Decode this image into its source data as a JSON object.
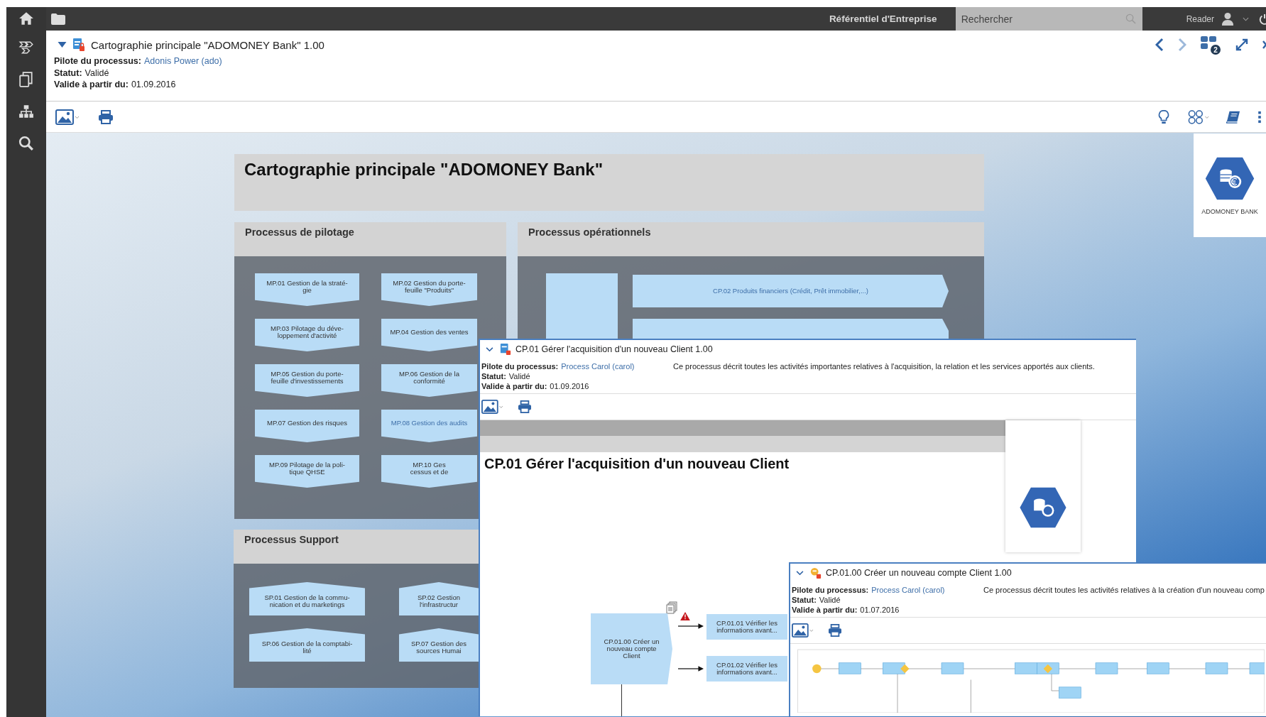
{
  "top_bar": {
    "repository": "Référentiel d'Entreprise",
    "search": {
      "placeholder": "Rechercher"
    },
    "user": "Reader"
  },
  "document": {
    "title": "Cartographie principale \"ADOMONEY Bank\" 1.00",
    "open_windows": "2",
    "fields": [
      {
        "label": "Pilote du processus:",
        "value": "Adonis Power (ado)",
        "link": true
      },
      {
        "label": "Statut:",
        "value": "Validé",
        "link": false
      },
      {
        "label": "Valide à partir du:",
        "value": "01.09.2016",
        "link": false
      }
    ]
  },
  "map": {
    "title": "Cartographie principale \"ADOMONEY Bank\"",
    "logo_text": "ADOMONEY BANK",
    "sections": [
      {
        "kind": "pilotage",
        "title": "Processus de pilotage",
        "items": [
          {
            "text": "MP.01 Gestion de la straté-\ngie",
            "link": false
          },
          {
            "text": "MP.02 Gestion du porte-\nfeuille \"Produits\"",
            "link": false
          },
          {
            "text": "MP.03 Pilotage du déve-\nloppement d'activité",
            "link": false
          },
          {
            "text": "MP.04 Gestion des ventes",
            "link": false
          },
          {
            "text": "MP.05 Gestion du porte-\nfeuille d'investissements",
            "link": false
          },
          {
            "text": "MP.06 Gestion de la\nconformité",
            "link": false
          },
          {
            "text": "MP.07 Gestion des risques",
            "link": false
          },
          {
            "text": "MP.08 Gestion des audits",
            "link": true
          },
          {
            "text": "MP.09 Pilotage de la poli-\ntique QHSE",
            "link": false
          },
          {
            "text": "MP.10 Ges\ncessus et de",
            "link": false
          }
        ]
      },
      {
        "kind": "operational",
        "title": "Processus opérationnels",
        "items": [
          {
            "text": "CP.02 Produits financiers (Crédit, Prêt immobilier,...)",
            "link": true
          }
        ]
      },
      {
        "kind": "support",
        "title": "Processus Support",
        "items": [
          {
            "text": "SP.01 Gestion de la commu-\nnication et du marketings",
            "link": false
          },
          {
            "text": "SP.02 Gestion\nl'infrastructur",
            "link": false
          },
          {
            "text": "SP.06 Gestion de la comptabi-\nlité",
            "link": false
          },
          {
            "text": "SP.07 Gestion des\nsources Humai",
            "link": false
          }
        ]
      }
    ]
  },
  "windows": [
    {
      "kind": "map",
      "title": "CP.01 Gérer l'acquisition d'un nouveau Client 1.00",
      "description": "Ce processus décrit toutes les activités importantes relatives à l'acquisition, la relation et les services apportés aux clients.",
      "fields": [
        {
          "label": "Pilote du processus:",
          "value": "Process Carol (carol)",
          "link": true
        },
        {
          "label": "Statut:",
          "value": "Validé",
          "link": false
        },
        {
          "label": "Valide à partir du:",
          "value": "01.09.2016",
          "link": false
        }
      ],
      "heading": "CP.01 Gérer l'acquisition d'un nouveau Client",
      "nodes": [
        {
          "kind": "process",
          "text": "CP.01.00 Créer un\nnouveau compte\nClient"
        },
        {
          "kind": "step",
          "text": "CP.01.01 Vérifier les\ninformations avant..."
        },
        {
          "kind": "step",
          "text": "CP.01.02 Vérifier les\ninformations avant..."
        }
      ]
    },
    {
      "kind": "bpmn",
      "title": "CP.01.00 Créer un nouveau compte Client 1.00",
      "description": "Ce processus décrit toutes les activités relatives à la création d'un nouveau comp",
      "fields": [
        {
          "label": "Pilote du processus:",
          "value": "Process Carol (carol)",
          "link": true
        },
        {
          "label": "Statut:",
          "value": "Validé",
          "link": false
        },
        {
          "label": "Valide à partir du:",
          "value": "01.07.2016",
          "link": false
        }
      ]
    }
  ]
}
